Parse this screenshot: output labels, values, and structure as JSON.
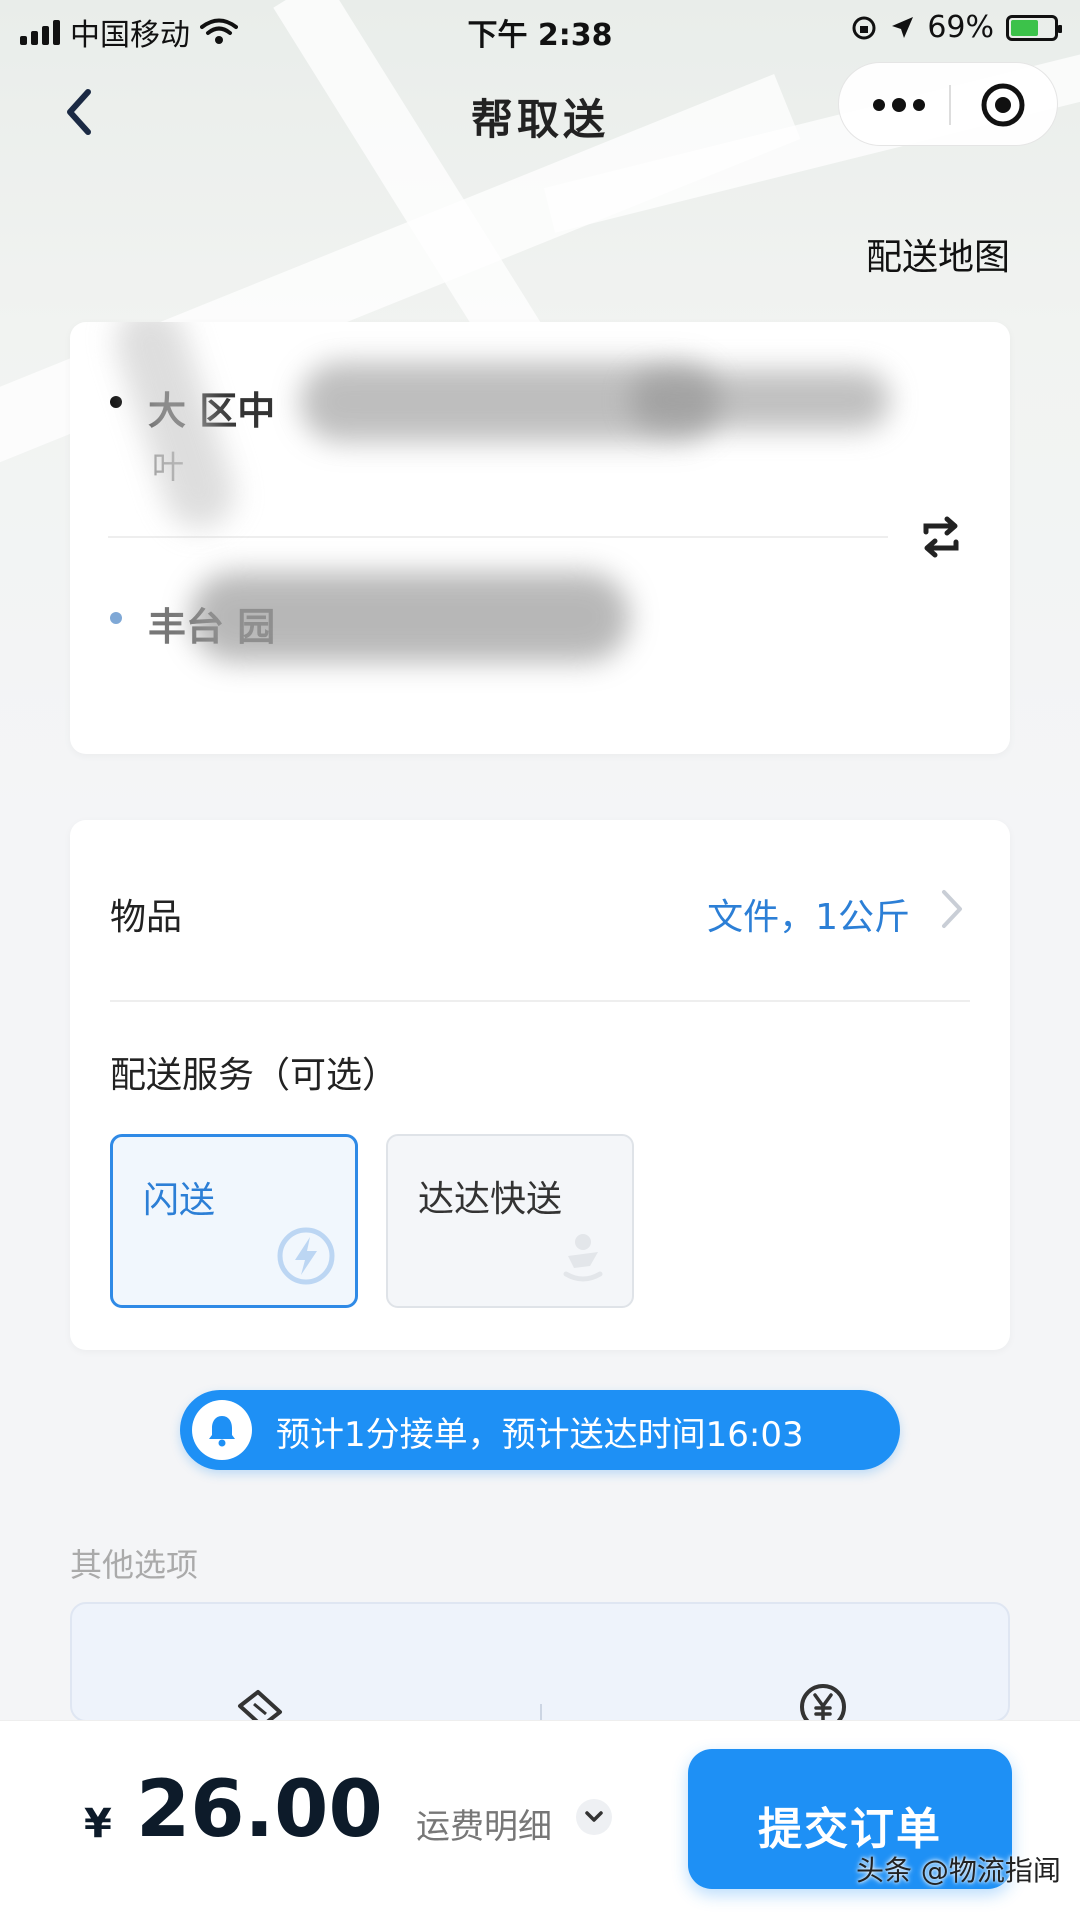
{
  "status_bar": {
    "carrier": "中国移动",
    "time": "下午 2:38",
    "battery": "69%"
  },
  "nav": {
    "title": "帮取送"
  },
  "map_link": "配送地图",
  "address": {
    "pickup_name": "大 区中",
    "pickup_detail": "叶",
    "dropoff_name": "丰台 园"
  },
  "goods": {
    "label": "物品",
    "value": "文件，1公斤"
  },
  "service": {
    "label": "配送服务（可选）",
    "options": [
      {
        "name": "闪送",
        "selected": true,
        "icon": "lightning-icon"
      },
      {
        "name": "达达快送",
        "selected": false,
        "icon": "dada-icon"
      }
    ]
  },
  "estimate": {
    "text": "预计1分接单，预计送达时间16:03",
    "icon": "bell-icon"
  },
  "other": {
    "label": "其他选项"
  },
  "bottom": {
    "currency": "¥",
    "price": "26.00",
    "fee_detail": "运费明细",
    "submit": "提交订单"
  },
  "watermark": "头条 @物流指闻",
  "colors": {
    "accent": "#1e90f5",
    "link_blue": "#2c7fd6",
    "price_dark": "#0d1b2a"
  }
}
